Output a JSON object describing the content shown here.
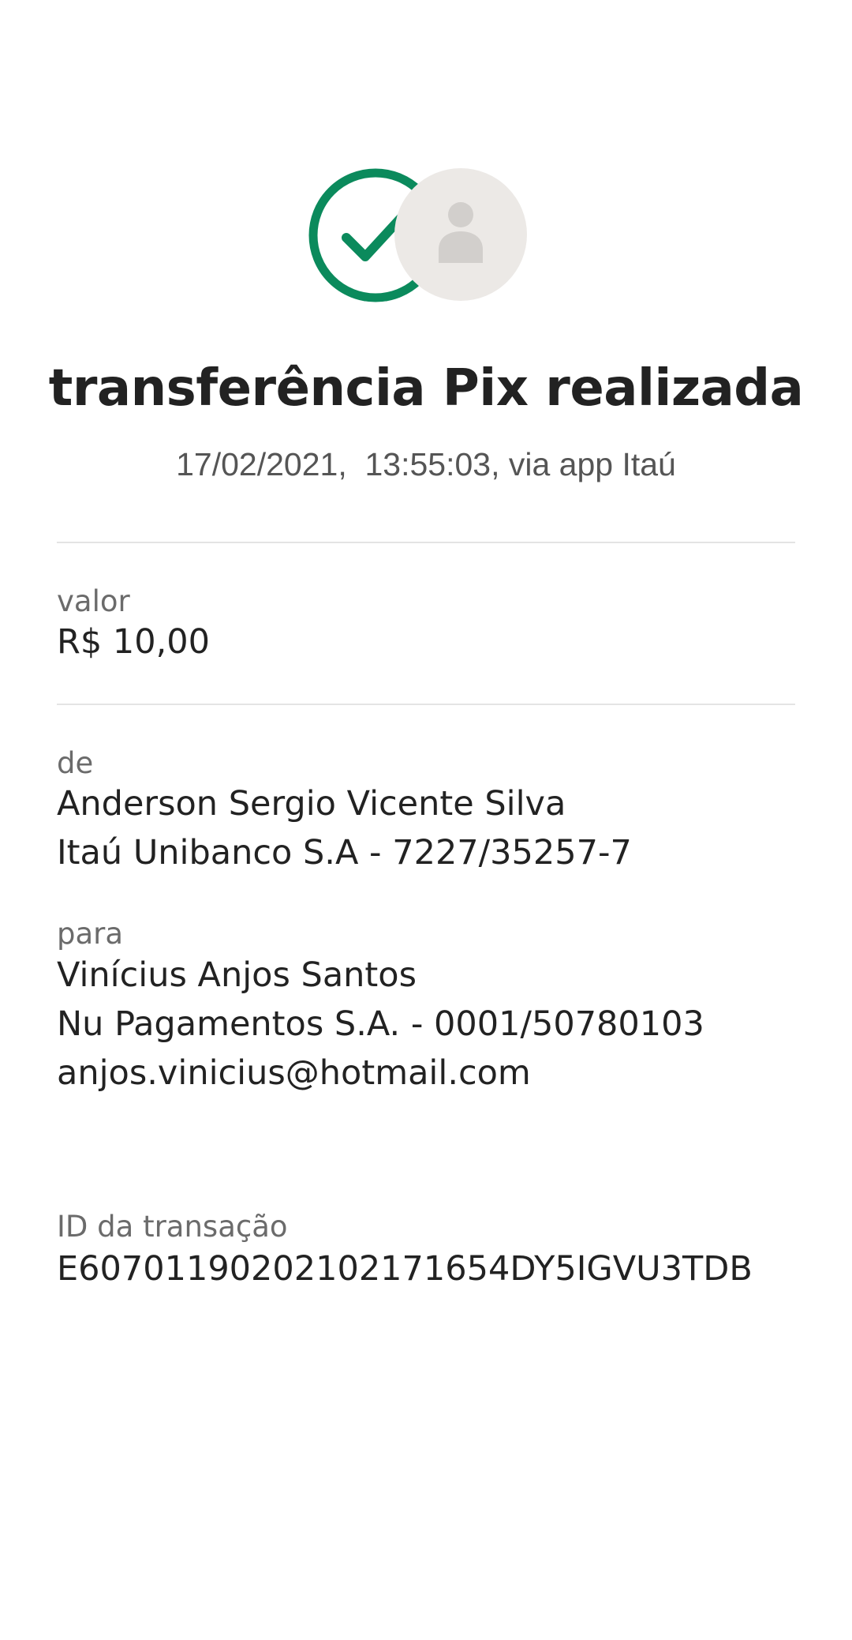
{
  "header": {
    "icons": {
      "status": "check-circle-icon",
      "recipient": "person-avatar-icon"
    },
    "colors": {
      "success": "#0b8a5c",
      "avatar_bg": "#ece9e6",
      "avatar_fg": "#d2cfcc"
    },
    "title": "transferência Pix realizada",
    "subtitle": "17/02/2021,  13:55:03, via app Itaú"
  },
  "amount": {
    "label": "valor",
    "value": "R$ 10,00"
  },
  "sender": {
    "label": "de",
    "name": "Anderson Sergio Vicente Silva",
    "bank": "Itaú Unibanco S.A - 7227/35257-7"
  },
  "recipient": {
    "label": "para",
    "name": "Vinícius Anjos Santos",
    "bank": "Nu Pagamentos S.A. - 0001/50780103",
    "pix_key": "anjos.vinicius@hotmail.com"
  },
  "transaction": {
    "label": "ID da transação",
    "id": "E60701190202102171654DY5IGVU3TDB"
  }
}
